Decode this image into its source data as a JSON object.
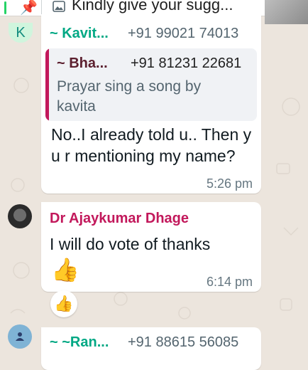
{
  "pinned": {
    "icon": "pin-icon",
    "thumbnail_icon": "image-icon",
    "text": "Kindly give your sugg..."
  },
  "messages": [
    {
      "avatar_letter": "K",
      "avatar_color": "#25D366",
      "sender_name": "~ Kavit...",
      "sender_color": "#00A884",
      "sender_phone": "+91 99021 74013",
      "quoted": {
        "name": "~ Bha...",
        "name_color": "#5B1F2E",
        "phone": "+91 81231 22681",
        "text": "Prayar sing a song by kavita"
      },
      "text": "No..I already told u.. Then y u r mentioning my name?",
      "time": "5:26 pm"
    },
    {
      "avatar_icon": "profile-photo",
      "sender_name": "Dr Ajaykumar Dhage",
      "sender_color": "#C2185B",
      "text": "I will do vote of thanks",
      "sticker": "👍",
      "time": "6:14 pm",
      "reaction": "👍"
    },
    {
      "avatar_icon": "person-icon",
      "avatar_color": "#7FB3D5",
      "sender_name": "~ ~Ran...",
      "sender_color": "#00A884",
      "sender_phone": "+91 88615 56085"
    }
  ]
}
